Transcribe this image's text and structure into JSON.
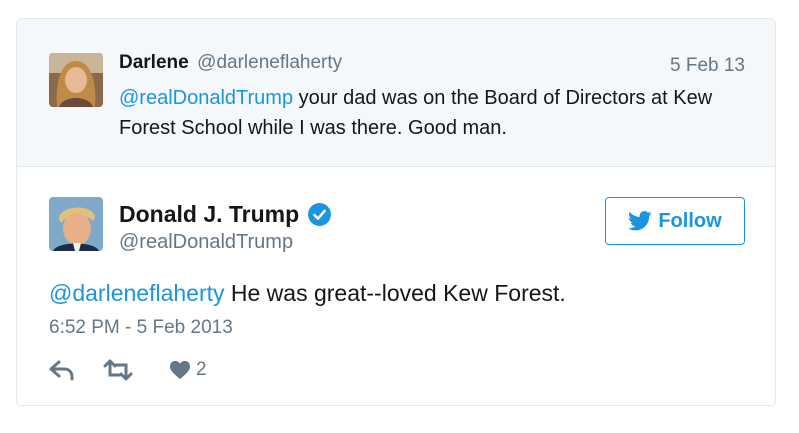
{
  "parent_tweet": {
    "author_name": "Darlene",
    "author_handle": "@darleneflaherty",
    "date": "5 Feb 13",
    "mention": "@realDonaldTrump",
    "text": " your dad was on the Board of Directors at Kew Forest School while I was there. Good man."
  },
  "main_tweet": {
    "author_name": "Donald J. Trump",
    "author_handle": "@realDonaldTrump",
    "verified_icon": "verified-badge-icon",
    "follow_label": "Follow",
    "mention": "@darleneflaherty",
    "text": " He was great--loved Kew Forest.",
    "timestamp": "6:52 PM - 5 Feb 2013",
    "like_count": "2"
  },
  "icons": {
    "reply": "reply-icon",
    "retweet": "retweet-icon",
    "like": "heart-icon",
    "follow": "twitter-bird-icon"
  },
  "colors": {
    "link": "#1b95e0",
    "muted": "#657786",
    "text": "#14171a",
    "parent_bg": "#f5f8fa",
    "border": "#e1e8ed"
  }
}
